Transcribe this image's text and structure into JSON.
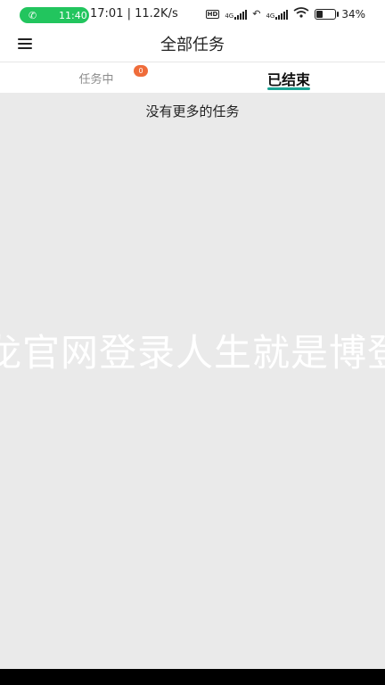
{
  "status_bar": {
    "call_time": "11:40",
    "time_speed": "17:01 | 11.2K/s",
    "network_tag_1": "4G",
    "network_tag_2": "4G",
    "hd_label": "HD",
    "battery_percent": 34,
    "battery_text": "34%"
  },
  "header": {
    "title": "全部任务"
  },
  "tabs": [
    {
      "label": "任务中",
      "badge": "0",
      "active": false
    },
    {
      "label": "已结束",
      "active": true
    }
  ],
  "content": {
    "empty_message": "没有更多的任务",
    "watermark": "龙官网登录人生就是博登"
  },
  "colors": {
    "accent": "#1aa394",
    "badge": "#ef6c3a",
    "call_pill": "#22c55e",
    "content_bg": "#eaeaea"
  }
}
